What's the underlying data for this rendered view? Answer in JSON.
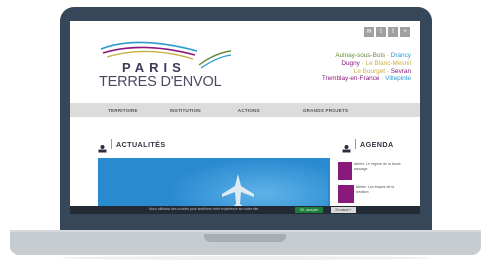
{
  "site": {
    "logo": {
      "line1": "PARIS",
      "line2": "TERRES D'ENVOL"
    },
    "social_icons": [
      "email-icon",
      "twitter-icon",
      "facebook-icon",
      "share-icon"
    ],
    "towns": [
      [
        {
          "text": "Aulnay-sous-Bois",
          "color": "#6a8a3a"
        },
        {
          "text": " · ",
          "color": "#888888"
        },
        {
          "text": "Drancy",
          "color": "#2a9ad0"
        }
      ],
      [
        {
          "text": "Dugny",
          "color": "#8a1a7a"
        },
        {
          "text": " · ",
          "color": "#888888"
        },
        {
          "text": "Le Blanc-Mesnil",
          "color": "#c8b040"
        }
      ],
      [
        {
          "text": "Le Bourget",
          "color": "#c8b040"
        },
        {
          "text": " · ",
          "color": "#888888"
        },
        {
          "text": "Sevran",
          "color": "#8a1a7a"
        }
      ],
      [
        {
          "text": "Tremblay-en-France",
          "color": "#8a1a7a"
        },
        {
          "text": " · ",
          "color": "#888888"
        },
        {
          "text": "Villepinte",
          "color": "#2a9ad0"
        }
      ]
    ],
    "nav": [
      "TERRITOIRE",
      "INSTITUTION",
      "ACTIONS",
      "GRANDS PROJETS"
    ],
    "news_heading": "ACTUALITÉS",
    "agenda_heading": "AGENDA",
    "agenda_items": [
      {
        "date": "",
        "text": "Atelier: Le régime de la faune sauvage"
      },
      {
        "date": "",
        "text": "Atelier: Les étapes de la création"
      }
    ],
    "cookie": {
      "message": "Nous utilisons des cookies pour améliorer votre expérience sur notre site",
      "accept": "OK, accepter",
      "more": "En savoir +"
    }
  },
  "colors": {
    "laptop_frame": "#37475a",
    "laptop_base": "#c7ccd1",
    "nav_bg": "#dcdcdc",
    "hero_blue": "#2a8ad0",
    "agenda_purple": "#8a1a7a",
    "cookie_bar": "#222a33"
  }
}
